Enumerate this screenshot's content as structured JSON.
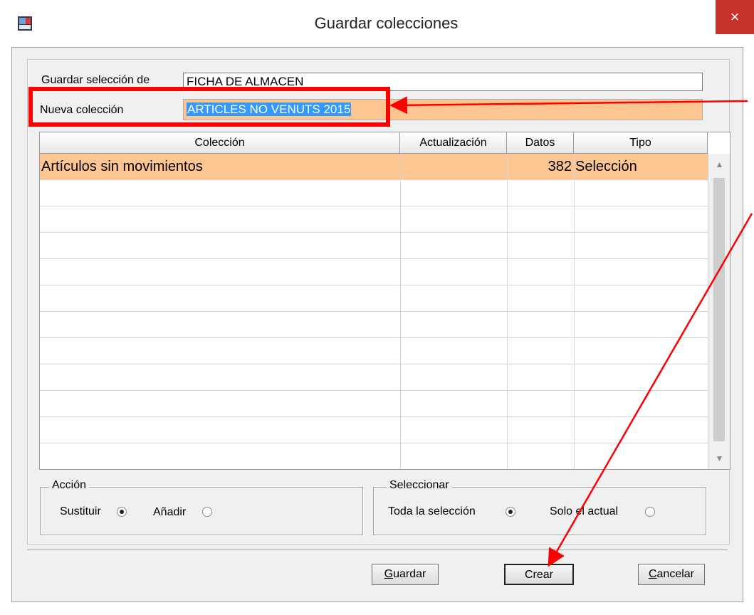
{
  "window": {
    "title": "Guardar colecciones",
    "close_glyph": "×",
    "app_icon": "app-icon"
  },
  "form": {
    "save_selection_label": "Guardar selección de",
    "save_selection_value": "FICHA DE ALMACEN",
    "new_collection_label": "Nueva colección",
    "new_collection_value": "ARTICLES NO VENUTS 2015"
  },
  "table": {
    "columns": [
      "Colección",
      "Actualización",
      "Datos",
      "Tipo"
    ],
    "rows": [
      {
        "coleccion": "Artículos sin movimientos",
        "actualizacion": "",
        "datos": "382",
        "tipo": "Selección",
        "selected": true
      }
    ],
    "empty_rows": 11
  },
  "accion": {
    "legend": "Acción",
    "options": [
      {
        "label": "Sustituir",
        "checked": true
      },
      {
        "label": "Añadir",
        "checked": false
      }
    ]
  },
  "seleccionar": {
    "legend": "Seleccionar",
    "options": [
      {
        "label": "Toda la selección",
        "checked": true
      },
      {
        "label": "Solo el actual",
        "checked": false
      }
    ]
  },
  "buttons": {
    "guardar": {
      "mnemonic": "G",
      "rest": "uardar"
    },
    "crear": {
      "label": "Crear"
    },
    "cancelar": {
      "mnemonic": "C",
      "rest": "ancelar"
    }
  },
  "colors": {
    "highlight_row": "#fcc591",
    "annotation": "#ff0000",
    "selection": "#3399ff",
    "close": "#c7332a"
  }
}
